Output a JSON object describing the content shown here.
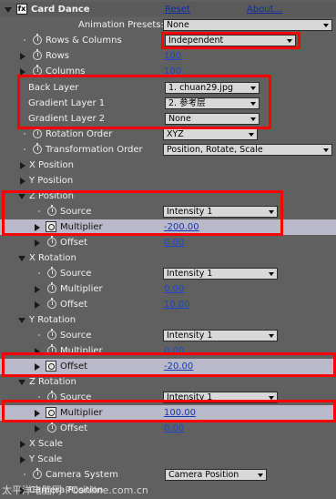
{
  "header": {
    "effect_name": "Card Dance",
    "reset_label": "Reset",
    "about_label": "About...",
    "presets_label": "Animation Presets:",
    "presets_value": "None"
  },
  "rows": {
    "rows_columns": {
      "label": "Rows & Columns",
      "value": "Independent"
    },
    "rows": {
      "label": "Rows",
      "value": "100"
    },
    "columns": {
      "label": "Columns",
      "value": "100"
    },
    "back_layer": {
      "label": "Back Layer",
      "value": "1. chuan29.jpg"
    },
    "gradient_layer_1": {
      "label": "Gradient Layer 1",
      "value": "2. 参考层"
    },
    "gradient_layer_2": {
      "label": "Gradient Layer 2",
      "value": "None"
    },
    "rotation_order": {
      "label": "Rotation Order",
      "value": "XYZ"
    },
    "transformation_order": {
      "label": "Transformation Order",
      "value": "Position, Rotate, Scale"
    },
    "x_position": {
      "label": "X Position"
    },
    "y_position": {
      "label": "Y Position"
    },
    "z_position": {
      "label": "Z Position"
    },
    "z_source": {
      "label": "Source",
      "value": "Intensity 1"
    },
    "z_multiplier": {
      "label": "Multiplier",
      "value": "-200.00"
    },
    "z_offset": {
      "label": "Offset",
      "value": "0.00"
    },
    "x_rotation": {
      "label": "X Rotation"
    },
    "xr_source": {
      "label": "Source",
      "value": "Intensity 1"
    },
    "xr_multiplier": {
      "label": "Multiplier",
      "value": "0.00"
    },
    "xr_offset": {
      "label": "Offset",
      "value": "10.00"
    },
    "y_rotation": {
      "label": "Y Rotation"
    },
    "yr_source": {
      "label": "Source",
      "value": "Intensity 1"
    },
    "yr_multiplier": {
      "label": "Multiplier",
      "value": "0.00"
    },
    "yr_offset": {
      "label": "Offset",
      "value": "-20.00"
    },
    "z_rotation": {
      "label": "Z Rotation"
    },
    "zr_source": {
      "label": "Source",
      "value": "Intensity 1"
    },
    "zr_multiplier": {
      "label": "Multiplier",
      "value": "100.00"
    },
    "zr_offset": {
      "label": "Offset",
      "value": "0.00"
    },
    "x_scale": {
      "label": "X Scale"
    },
    "y_scale": {
      "label": "Y Scale"
    },
    "camera_system": {
      "label": "Camera System",
      "value": "Camera Position"
    },
    "camera_position": {
      "label": "Camera Position"
    }
  },
  "watermark": "太平洋电脑网 PConline.com.cn",
  "colors": {
    "panel_bg": "#606060",
    "selected_row": "#b9b9c9",
    "value_link": "#1f47c8",
    "annotation_red": "#ff0000"
  }
}
